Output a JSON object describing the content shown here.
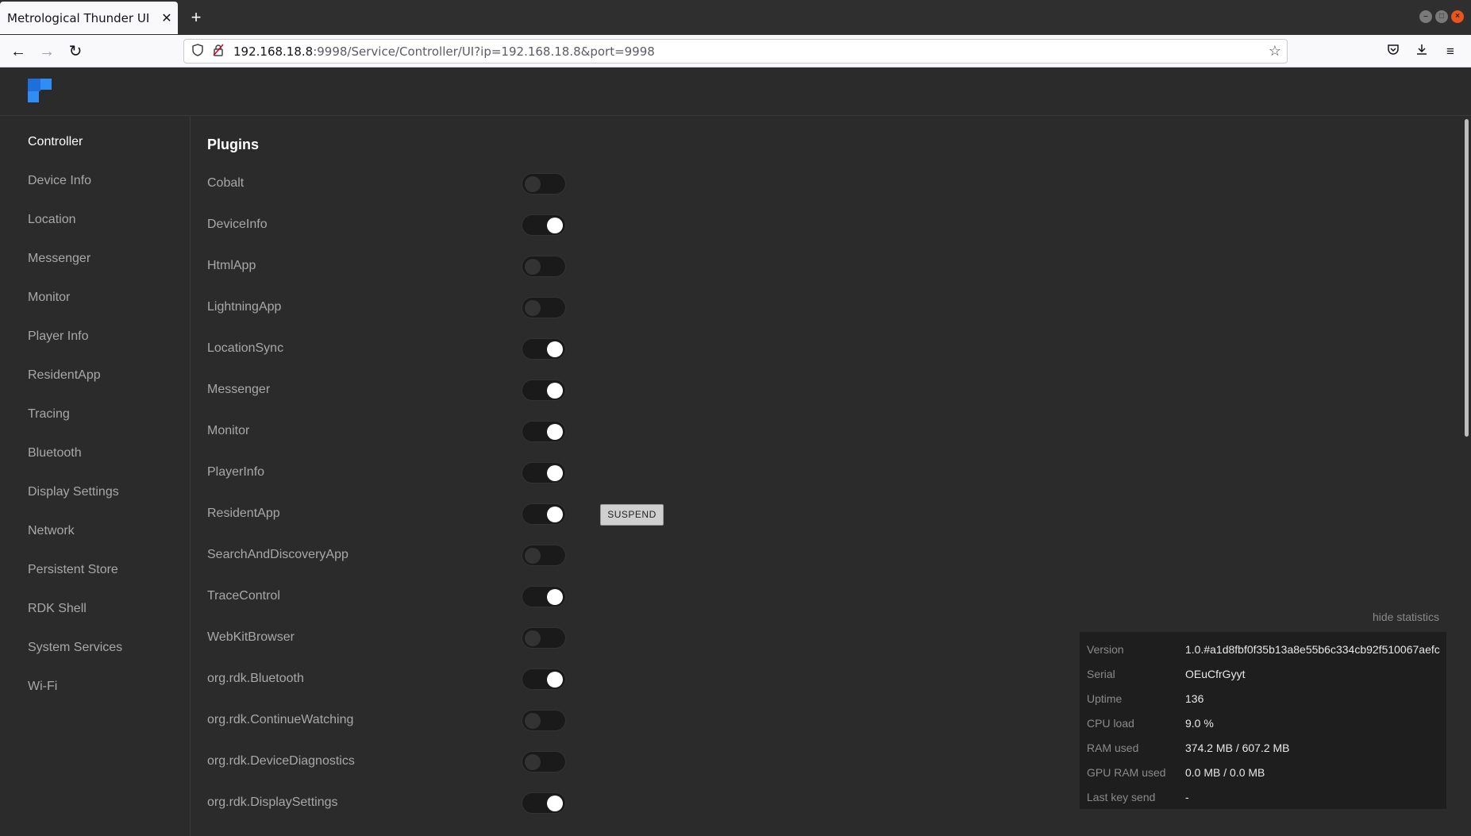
{
  "browser": {
    "tab_title": "Metrological Thunder UI",
    "url_host": "192.168.18.8",
    "url_rest": ":9998/Service/Controller/UI?ip=192.168.18.8&port=9998"
  },
  "sidebar": {
    "items": [
      {
        "label": "Controller"
      },
      {
        "label": "Device Info"
      },
      {
        "label": "Location"
      },
      {
        "label": "Messenger"
      },
      {
        "label": "Monitor"
      },
      {
        "label": "Player Info"
      },
      {
        "label": "ResidentApp"
      },
      {
        "label": "Tracing"
      },
      {
        "label": "Bluetooth"
      },
      {
        "label": "Display Settings"
      },
      {
        "label": "Network"
      },
      {
        "label": "Persistent Store"
      },
      {
        "label": "RDK Shell"
      },
      {
        "label": "System Services"
      },
      {
        "label": "Wi-Fi"
      }
    ]
  },
  "main": {
    "title": "Plugins",
    "suspend_label": "SUSPEND",
    "plugins": [
      {
        "name": "Cobalt",
        "enabled": false
      },
      {
        "name": "DeviceInfo",
        "enabled": true
      },
      {
        "name": "HtmlApp",
        "enabled": false
      },
      {
        "name": "LightningApp",
        "enabled": false
      },
      {
        "name": "LocationSync",
        "enabled": true
      },
      {
        "name": "Messenger",
        "enabled": true
      },
      {
        "name": "Monitor",
        "enabled": true
      },
      {
        "name": "PlayerInfo",
        "enabled": true
      },
      {
        "name": "ResidentApp",
        "enabled": true
      },
      {
        "name": "SearchAndDiscoveryApp",
        "enabled": false
      },
      {
        "name": "TraceControl",
        "enabled": true
      },
      {
        "name": "WebKitBrowser",
        "enabled": false
      },
      {
        "name": "org.rdk.Bluetooth",
        "enabled": true
      },
      {
        "name": "org.rdk.ContinueWatching",
        "enabled": false
      },
      {
        "name": "org.rdk.DeviceDiagnostics",
        "enabled": false
      },
      {
        "name": "org.rdk.DisplaySettings",
        "enabled": true
      }
    ]
  },
  "statistics": {
    "toggle_label": "hide statistics",
    "rows": [
      {
        "label": "Version",
        "value": "1.0.#a1d8fbf0f35b13a8e55b6c334cb92f510067aefc"
      },
      {
        "label": "Serial",
        "value": "OEuCfrGyyt"
      },
      {
        "label": "Uptime",
        "value": "136"
      },
      {
        "label": "CPU load",
        "value": "9.0 %"
      },
      {
        "label": "RAM used",
        "value": "374.2 MB / 607.2 MB"
      },
      {
        "label": "GPU RAM used",
        "value": "0.0 MB / 0.0 MB"
      },
      {
        "label": "Last key send",
        "value": "-"
      }
    ]
  }
}
